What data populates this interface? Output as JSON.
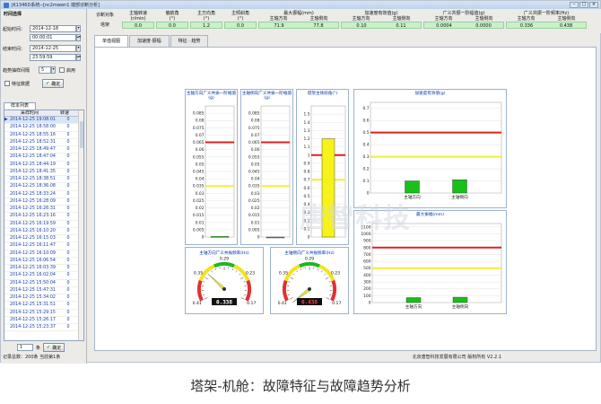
{
  "window": {
    "title": "JK1346D系统--[nc2mwen1 端部诊断分析]"
  },
  "left": {
    "section_title": "时间选择",
    "start_label": "起始时间：",
    "start_date": "2014-12-18",
    "start_time": "00:00:01",
    "end_label": "结束时间：",
    "end_date": "2014-12-25",
    "end_time": "23:59:59",
    "trend_label": "趋势抽样间隔",
    "trend_value": "5",
    "enable_label": "启用",
    "feature_label": "特征数据",
    "confirm_label": "确定",
    "list_tab": "样本列表",
    "col_time": "采样时间",
    "col_speed": "转速",
    "rows": [
      {
        "t": "2014-12-25 19:08:01",
        "s": "0"
      },
      {
        "t": "2014-12-25 18:58:00",
        "s": "0"
      },
      {
        "t": "2014-12-25 18:55:16",
        "s": "0"
      },
      {
        "t": "2014-12-25 18:52:31",
        "s": "0"
      },
      {
        "t": "2014-12-25 18:49:47",
        "s": "0"
      },
      {
        "t": "2014-12-25 18:47:04",
        "s": "0"
      },
      {
        "t": "2014-12-25 18:44:19",
        "s": "0"
      },
      {
        "t": "2014-12-25 18:41:35",
        "s": "0"
      },
      {
        "t": "2014-12-25 18:38:51",
        "s": "0"
      },
      {
        "t": "2014-12-25 18:36:08",
        "s": "0"
      },
      {
        "t": "2014-12-25 18:33:24",
        "s": "0"
      },
      {
        "t": "2014-12-25 16:28:09",
        "s": "0"
      },
      {
        "t": "2014-12-25 16:26:31",
        "s": "0"
      },
      {
        "t": "2014-12-25 16:23:16",
        "s": "0"
      },
      {
        "t": "2014-12-25 16:19:59",
        "s": "0"
      },
      {
        "t": "2014-12-25 16:10:20",
        "s": "0"
      },
      {
        "t": "2014-12-25 16:15:03",
        "s": "0"
      },
      {
        "t": "2014-12-25 16:11:47",
        "s": "0"
      },
      {
        "t": "2014-12-25 16:10:09",
        "s": "0"
      },
      {
        "t": "2014-12-25 16:06:54",
        "s": "0"
      },
      {
        "t": "2014-12-25 16:03:39",
        "s": "0"
      },
      {
        "t": "2014-12-25 16:02:04",
        "s": "0"
      },
      {
        "t": "2014-12-25 15:50:04",
        "s": "0"
      },
      {
        "t": "2014-12-25 15:47:31",
        "s": "0"
      },
      {
        "t": "2014-12-25 15:34:02",
        "s": "0"
      },
      {
        "t": "2014-12-25 15:31:51",
        "s": "0"
      },
      {
        "t": "2014-12-25 15:29:15",
        "s": "0"
      },
      {
        "t": "2014-12-25 15:26:17",
        "s": "0"
      },
      {
        "t": "2014-12-25 15:23:37",
        "s": "0"
      }
    ],
    "page_value": "1",
    "page_unit": "条",
    "page_confirm": "确定"
  },
  "header": {
    "label_top": "诊断对象",
    "label_bottom": "塔架",
    "cols": [
      {
        "h": "主轴转速\n(r/min)",
        "v": "0.0"
      },
      {
        "h": "偏航角\n(°)",
        "v": "0.0"
      },
      {
        "h": "主方向角\n(°)",
        "v": "1.2"
      },
      {
        "h": "主倾斜角\n(°)",
        "v": "0.0"
      }
    ],
    "groups": [
      {
        "h": "最大振幅(mm)",
        "subs": [
          "主轴方向",
          "主轴侧向"
        ],
        "vals": [
          "71.9",
          "77.8"
        ]
      },
      {
        "h": "加速度有效值(g)",
        "subs": [
          "主轴方向",
          "主轴侧向"
        ],
        "vals": [
          "0.10",
          "0.11"
        ]
      },
      {
        "h": "广义共振一阶幅值(g)",
        "subs": [
          "主轴方向",
          "主轴侧向"
        ],
        "vals": [
          "0.0004",
          "0.0000"
        ]
      },
      {
        "h": "广义共振一阶频率(Hz)",
        "subs": [
          "主轴方向",
          "主轴侧向"
        ],
        "vals": [
          "0.336",
          "0.438"
        ]
      }
    ]
  },
  "tabs": [
    "单值视图",
    "加速度·振幅",
    "特征 · 趋势"
  ],
  "status": {
    "left": "记录总数：200条 当前第1条",
    "right": "北京唐智科技发展有限公司 版权所有 V2.2.1"
  },
  "watermark": "唐智科技",
  "caption": "塔架-机舱：故障特征与故障趋势分析",
  "chart_data": [
    {
      "type": "bar",
      "title": "主轴方向广义共振一阶幅值(g)",
      "ylim": [
        0,
        0.09
      ],
      "yticks": [
        0,
        0.005,
        0.01,
        0.015,
        0.02,
        0.025,
        0.03,
        0.035,
        0.04,
        0.045,
        0.05,
        0.055,
        0.06,
        0.065,
        0.07,
        0.075,
        0.08,
        0.085
      ],
      "values": [
        0.0004
      ],
      "alarm": 0.065,
      "warn": 0.035
    },
    {
      "type": "bar",
      "title": "主轴侧向广义共振一阶幅值(g)",
      "ylim": [
        0,
        0.09
      ],
      "yticks": [
        0,
        0.005,
        0.01,
        0.015,
        0.02,
        0.025,
        0.03,
        0.035,
        0.04,
        0.045,
        0.05,
        0.055,
        0.06,
        0.065,
        0.07,
        0.075,
        0.08,
        0.085
      ],
      "values": [
        0.0
      ],
      "alarm": 0.065,
      "warn": 0.035
    },
    {
      "type": "bar",
      "title": "塔架主倾斜角(°)",
      "ylim": [
        0,
        1.6
      ],
      "yticks": [
        0,
        0.1,
        0.2,
        0.3,
        0.4,
        0.5,
        0.6,
        0.7,
        0.8,
        0.9,
        1,
        1.1,
        1.2,
        1.3,
        1.4,
        1.5
      ],
      "values": [
        1.2
      ],
      "alarm": 1.0,
      "warn": 0.7
    },
    {
      "type": "bar",
      "title": "加速度有效值(g)",
      "categories": [
        "主轴方向",
        "主轴侧向"
      ],
      "ylim": [
        0,
        0.75
      ],
      "yticks": [
        0,
        0.1,
        0.2,
        0.3,
        0.4,
        0.5,
        0.6,
        0.7
      ],
      "values": [
        0.1,
        0.11
      ],
      "alarm": 0.5,
      "warn": 0.3
    },
    {
      "type": "bar",
      "title": "最大振幅(mm)",
      "categories": [
        "主轴方向",
        "主轴侧向"
      ],
      "ylim": [
        0,
        1150
      ],
      "yticks": [
        0,
        100,
        200,
        300,
        400,
        500,
        600,
        700,
        800,
        900,
        1000,
        1100
      ],
      "values": [
        71.9,
        77.8
      ],
      "alarm": 800,
      "warn": 500
    }
  ],
  "gauges": [
    {
      "title": "主轴方向广义共振频率(Hz)",
      "min": 0.17,
      "max": 0.41,
      "ticks": [
        "0.41",
        "0.35",
        "0.29",
        "0.23",
        "0.17"
      ],
      "value": "0.338"
    },
    {
      "title": "主轴侧向广义共振频率(Hz)",
      "min": 0.17,
      "max": 0.41,
      "ticks": [
        "0.41",
        "0.35",
        "0.29",
        "0.23",
        "0.17"
      ],
      "value": "0.438"
    }
  ]
}
